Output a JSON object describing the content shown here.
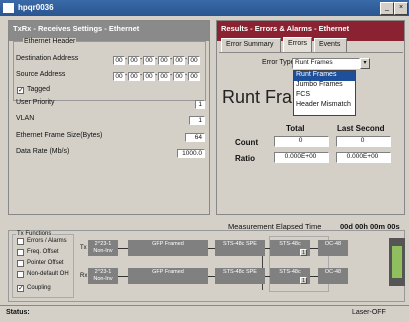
{
  "window": {
    "title": "hpqr0036",
    "min": "_",
    "close": "×"
  },
  "left_panel": {
    "header": "TxRx - Receives Settings - Ethernet",
    "group_title": "Ethernet Header",
    "dest_label": "Destination Address",
    "dest_octets": [
      "00",
      "00",
      "00",
      "00",
      "00",
      "00"
    ],
    "src_label": "Source Address",
    "src_octets": [
      "00",
      "00",
      "00",
      "00",
      "00",
      "00"
    ],
    "tagged_label": "Tagged",
    "user_priority_label": "User Priority",
    "user_priority_value": "1",
    "vlan_label": "VLAN",
    "vlan_value": "1",
    "frame_size_label": "Ethernet Frame Size(Bytes)",
    "frame_size_value": "64",
    "data_rate_label": "Data Rate (Mb/s)",
    "data_rate_value": "1000.0"
  },
  "right_panel": {
    "header": "Results - Errors & Alarms - Ethernet",
    "tabs": [
      "Error Summary",
      "Errors",
      "Events"
    ],
    "error_type_label": "Error Type",
    "error_type_value": "Runt Frames",
    "dropdown_options": [
      "Runt Frames",
      "Jumbo Frames",
      "FCS",
      "Header Mismatch"
    ],
    "big_title": "Runt Fram",
    "col_total": "Total",
    "col_last": "Last Second",
    "count_label": "Count",
    "count_total": "0",
    "count_last": "0",
    "ratio_label": "Ratio",
    "ratio_total": "0.000E+00",
    "ratio_last": "0.000E+00"
  },
  "elapsed": {
    "label": "Measurement Elapsed Time",
    "value": "00d 00h 00m 00s"
  },
  "tx_functions": {
    "title": "Tx Functions",
    "items": [
      "Errors / Alarms",
      "Freq. Offset",
      "Pointer Offset",
      "Non-default OH"
    ],
    "coupling": "Coupling"
  },
  "diagram": {
    "tx": "Tx",
    "rx": "Rx",
    "tx_blocks": [
      "2^23-1 Non-Inv",
      "GFP Framed",
      "STS-48c SPE",
      "STS-48c",
      "OC-48"
    ],
    "rx_blocks": [
      "2^23-1 Non-Inv",
      "GFP Framed",
      "STS-48c SPE",
      "STS-48c",
      "OC-48"
    ],
    "subs": [
      "1",
      "1"
    ]
  },
  "status": {
    "label": "Status:",
    "laser": "Laser-OFF"
  }
}
